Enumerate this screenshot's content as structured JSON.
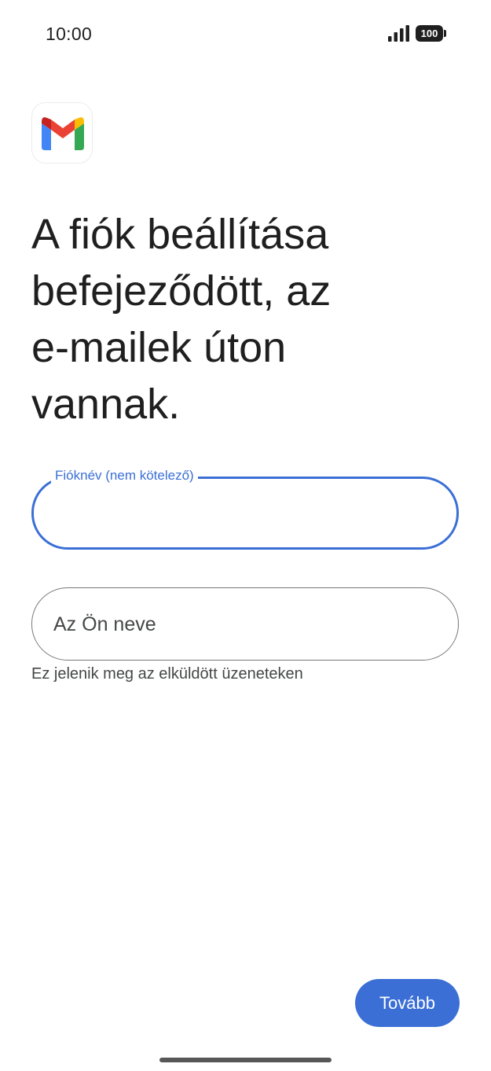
{
  "status_bar": {
    "time": "10:00",
    "battery_level": "100",
    "signal_icon": "cellular-signal-icon",
    "battery_icon": "battery-icon"
  },
  "app": {
    "logo_icon": "gmail-logo-icon"
  },
  "headline": "A fiók beállítása\nbefejeződött, az\ne-mailek úton\nvannak.",
  "account_name_field": {
    "label": "Fióknév (nem kötelező)",
    "value": "",
    "focused": true
  },
  "your_name_field": {
    "placeholder": "Az Ön neve",
    "value": "",
    "helper": "Ez jelenik meg az elküldött üzeneteken"
  },
  "next_button": {
    "label": "Tovább"
  },
  "colors": {
    "accent": "#3b6fd6",
    "text": "#1f1f1f",
    "secondary_text": "#444746",
    "outline": "#747775"
  }
}
